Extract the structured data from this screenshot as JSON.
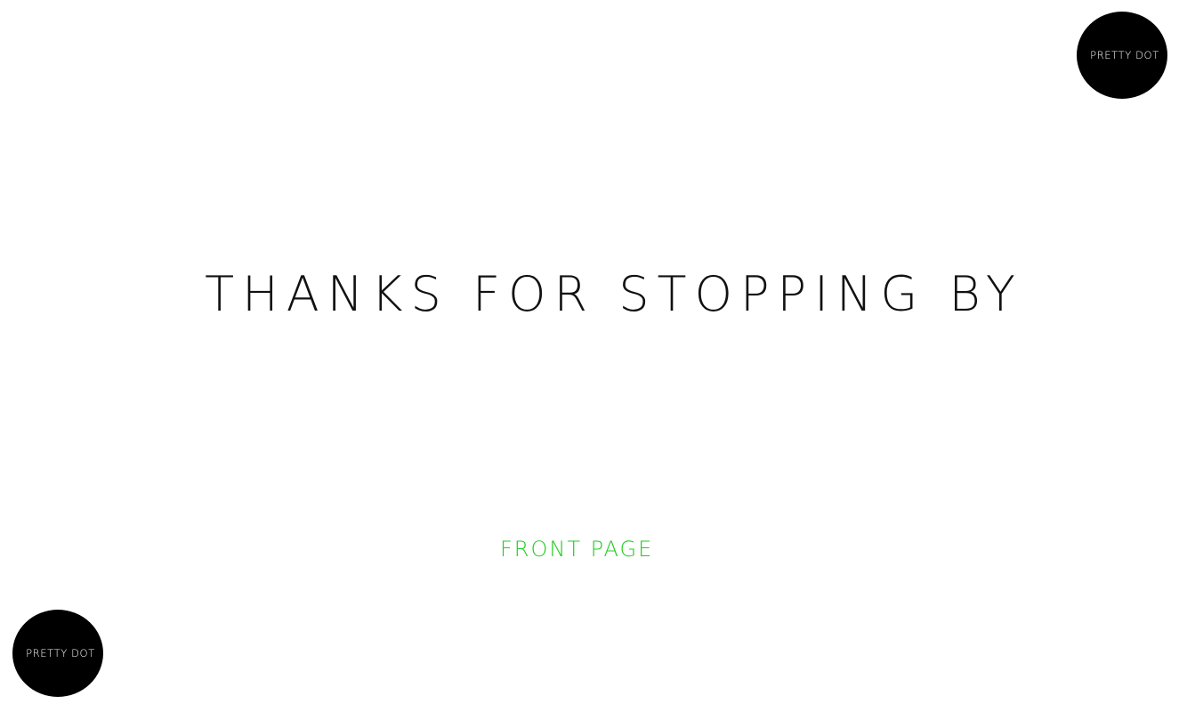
{
  "brand": {
    "logo_text": "PRETTY DOT"
  },
  "main": {
    "headline": "THANKS FOR STOPPING BY",
    "front_page_link": "FRONT PAGE"
  },
  "colors": {
    "link": "#22cc22",
    "badge": "#000000",
    "background": "#ffffff"
  }
}
